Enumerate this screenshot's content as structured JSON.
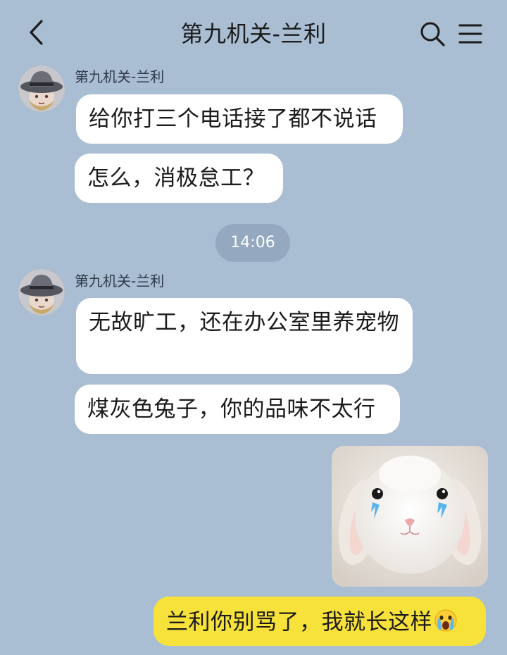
{
  "header": {
    "title": "第九机关-兰利"
  },
  "messages": {
    "group1": {
      "sender": "第九机关-兰利",
      "m1": "给你打三个电话接了都不说话",
      "m2": "怎么，消极怠工？"
    },
    "time": "14:06",
    "group2": {
      "sender": "第九机关-兰利",
      "m1": "无故旷工，还在办公室里养宠物",
      "m2": "煤灰色兔子，你的品味不太行"
    },
    "mine": {
      "text": "兰利你别骂了，我就长这样"
    }
  },
  "icons": {
    "back": "chevron-left-icon",
    "search": "search-icon",
    "menu": "hamburger-menu-icon",
    "crying_emoji": "crying-face-emoji-icon"
  },
  "colors": {
    "background": "#a9bdd3",
    "bubble_incoming": "#ffffff",
    "bubble_outgoing": "#f7e13b",
    "time_pill": "#94a8bf"
  }
}
